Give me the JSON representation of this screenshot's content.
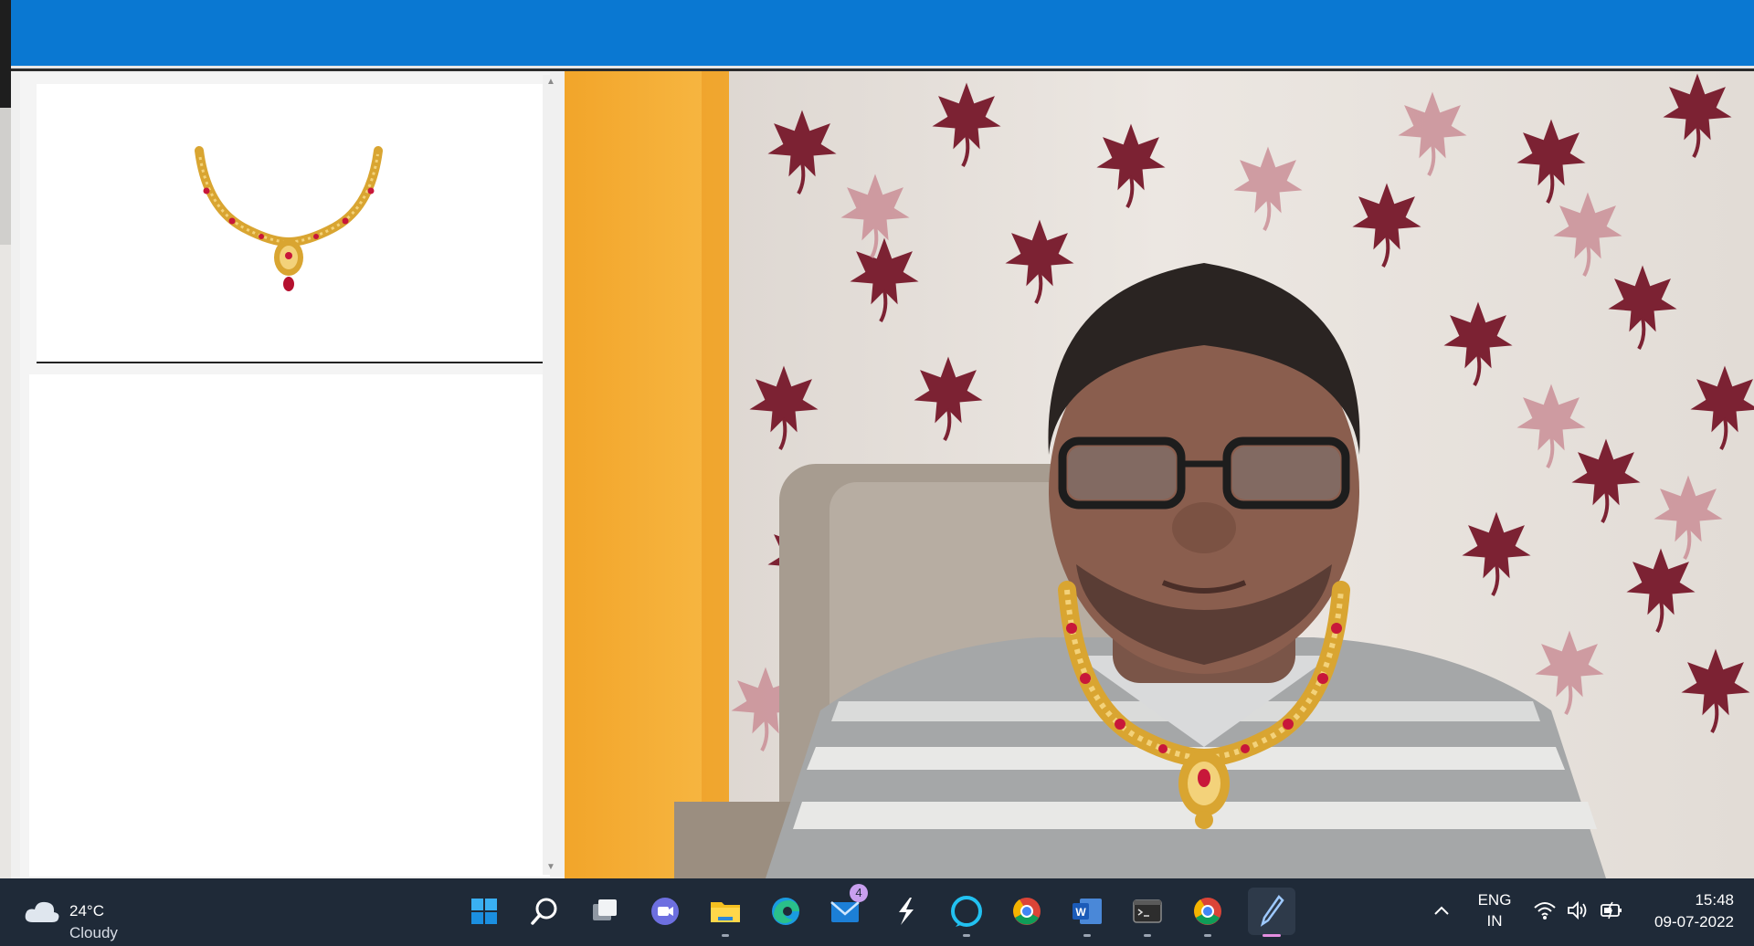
{
  "taskbar": {
    "weather": {
      "temperature": "24°C",
      "condition": "Cloudy",
      "icon": "cloud-icon"
    },
    "pinned_apps": [
      {
        "name": "start-icon"
      },
      {
        "name": "search-icon"
      },
      {
        "name": "task-view-icon"
      },
      {
        "name": "teams-chat-icon"
      },
      {
        "name": "file-explorer-icon"
      },
      {
        "name": "edge-icon"
      },
      {
        "name": "mail-icon",
        "badge": "4"
      },
      {
        "name": "app-lightning-icon"
      },
      {
        "name": "alexa-icon"
      },
      {
        "name": "chrome-icon"
      },
      {
        "name": "word-icon"
      },
      {
        "name": "terminal-icon"
      },
      {
        "name": "chrome-icon"
      },
      {
        "name": "pen-app-icon"
      }
    ],
    "tray": {
      "language_line1": "ENG",
      "language_line2": "IN",
      "icons": [
        "chevron-up-icon",
        "wifi-icon",
        "volume-icon",
        "battery-charging-icon"
      ]
    },
    "clock": {
      "time": "15:48",
      "date": "09-07-2022"
    }
  },
  "colors": {
    "titlebar": "#0a78d2",
    "taskbar": "#1f2a38",
    "gold": "#d9a531",
    "ruby": "#c8173a"
  }
}
